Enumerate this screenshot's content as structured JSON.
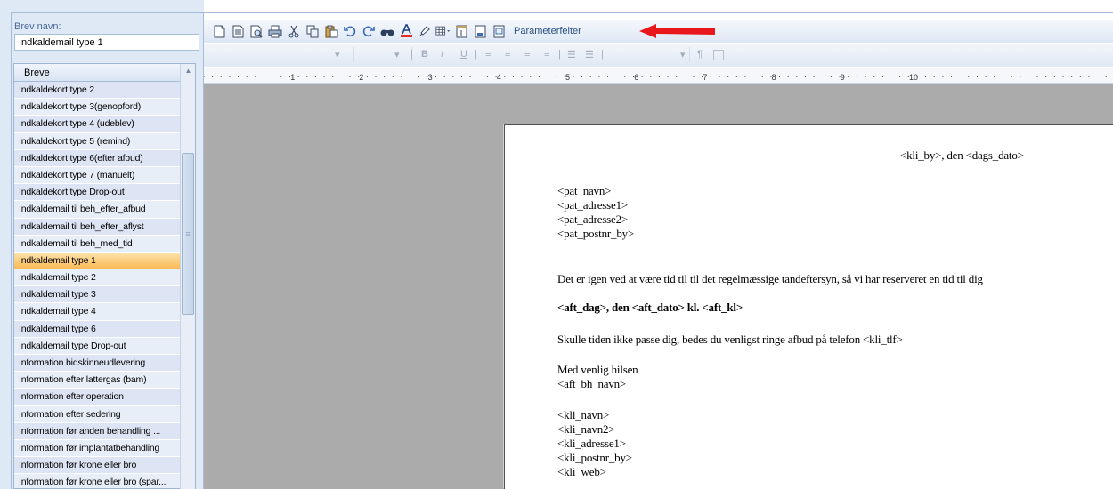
{
  "letter_name": {
    "label": "Brev navn:",
    "value": "Indkaldemail type 1"
  },
  "list": {
    "header": "Breve",
    "selected": "Indkaldemail type 1",
    "items": [
      "Indkaldekort type 2",
      "Indkaldekort type 3(genopford)",
      "Indkaldekort type 4 (udeblev)",
      "Indkaldekort type 5 (remind)",
      "Indkaldekort type 6(efter afbud)",
      "Indkaldekort type 7 (manuelt)",
      "Indkaldekort type Drop-out",
      "Indkaldemail til beh_efter_afbud",
      "Indkaldemail til beh_efter_aflyst",
      "Indkaldemail til beh_med_tid",
      "Indkaldemail type 1",
      "Indkaldemail type 2",
      "Indkaldemail type 3",
      "Indkaldemail type 4",
      "Indkaldemail type 6",
      "Indkaldemail type Drop-out",
      "Information bidskinneudlevering",
      "Information efter lattergas (bam)",
      "Information efter operation",
      "Information efter sedering",
      "Information før anden behandling ...",
      "Information før implantatbehandling",
      "Information før krone eller bro",
      "Information før krone eller bro (spar..."
    ]
  },
  "toolbar": {
    "icons": [
      "new-document-icon",
      "open-icon",
      "print-preview-icon",
      "print-icon",
      "cut-icon",
      "copy-icon",
      "paste-icon",
      "undo-icon",
      "redo-icon",
      "find-icon",
      "font-color-icon",
      "highlight-icon",
      "table-icon",
      "field-icon",
      "insert-icon",
      "page-setup-icon"
    ],
    "parameter_fields_label": "Parameterfelter",
    "arrow_color": "#e8171c"
  },
  "format_toolbar": {
    "bold": "B",
    "italic": "I",
    "underline": "U",
    "pilcrow": "¶"
  },
  "ruler": {
    "numbers": [
      "1",
      "2",
      "3",
      "4",
      "5",
      "6",
      "7",
      "8",
      "9",
      "10"
    ]
  },
  "document": {
    "date_line": "<kli_by>, den <dags_dato>",
    "address": [
      "<pat_navn>",
      "<pat_adresse1>",
      "<pat_adresse2>",
      "<pat_postnr_by>"
    ],
    "body_line": "Det er igen ved at være tid til til det regelmæssige tandeftersyn, så vi  har reserveret en tid til dig",
    "appointment_line": "<aft_dag>, den <aft_dato> kl. <aft_kl>",
    "cancel_line": "Skulle tiden ikke passe dig, bedes du venligst ringe afbud på telefon   <kli_tlf>",
    "greeting": "Med venlig hilsen",
    "signer": "<aft_bh_navn>",
    "clinic": [
      "<kli_navn>",
      "<kli_navn2>",
      "<kli_adresse1>",
      "<kli_postnr_by>",
      "<kli_web>"
    ]
  }
}
